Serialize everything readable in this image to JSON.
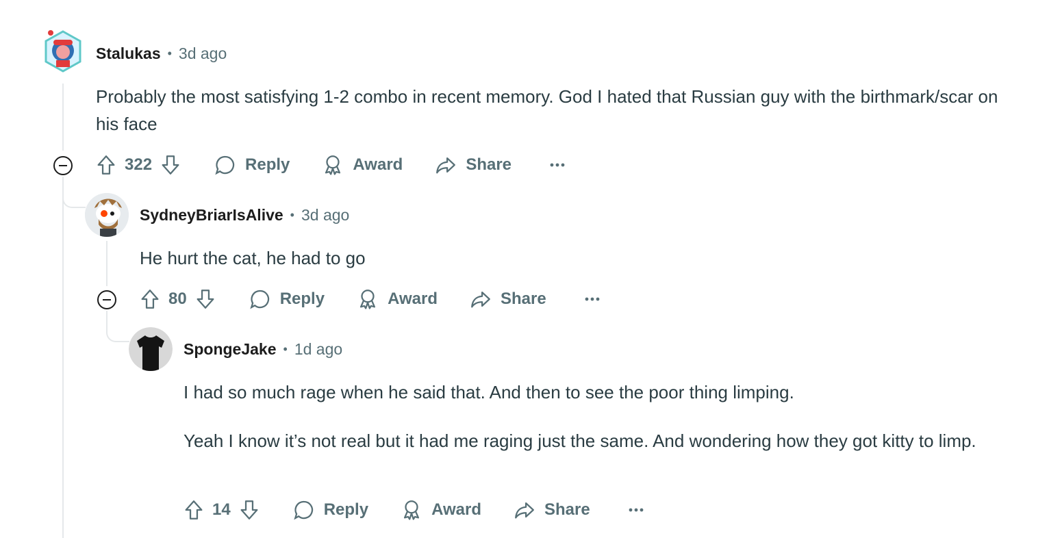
{
  "comments": [
    {
      "author": "Stalukas",
      "time": "3d ago",
      "paragraphs": [
        "Probably the most satisfying 1-2 combo in recent memory. God I hated that Russian guy with the birthmark/scar on his face"
      ],
      "score": "322",
      "reply_label": "Reply",
      "award_label": "Award",
      "share_label": "Share"
    },
    {
      "author": "SydneyBriarIsAlive",
      "time": "3d ago",
      "paragraphs": [
        "He hurt the cat, he had to go"
      ],
      "score": "80",
      "reply_label": "Reply",
      "award_label": "Award",
      "share_label": "Share"
    },
    {
      "author": "SpongeJake",
      "time": "1d ago",
      "paragraphs": [
        "I had so much rage when he said that. And then to see the poor thing limping.",
        "Yeah I know it’s not real but it had me raging just the same. And wondering how they got kitty to limp."
      ],
      "score": "14",
      "reply_label": "Reply",
      "award_label": "Award",
      "share_label": "Share"
    }
  ],
  "separator": "•",
  "icons": [
    "upvote-icon",
    "downvote-icon",
    "comment-bubble-icon",
    "award-ribbon-icon",
    "share-arrow-icon",
    "more-options-icon",
    "collapse-thread-icon"
  ],
  "colors": {
    "meta": "#576f76",
    "body": "#2a3c42",
    "thread_line": "#e5e8ea"
  }
}
